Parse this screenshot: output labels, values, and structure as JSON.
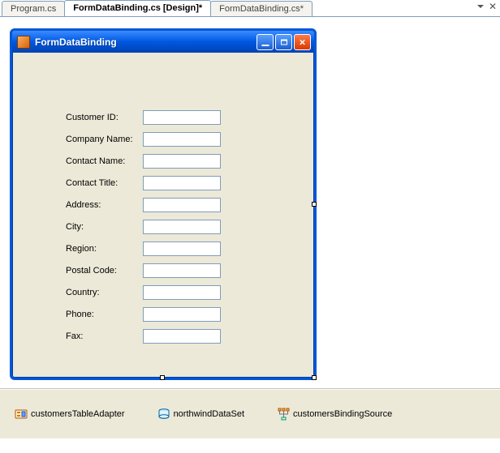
{
  "tabs": {
    "items": [
      {
        "label": "Program.cs"
      },
      {
        "label": "FormDataBinding.cs [Design]*"
      },
      {
        "label": "FormDataBinding.cs*"
      }
    ],
    "active_index": 1
  },
  "form": {
    "title": "FormDataBinding",
    "fields": [
      {
        "label": "Customer ID:"
      },
      {
        "label": "Company Name:"
      },
      {
        "label": "Contact Name:"
      },
      {
        "label": "Contact Title:"
      },
      {
        "label": "Address:"
      },
      {
        "label": "City:"
      },
      {
        "label": "Region:"
      },
      {
        "label": "Postal Code:"
      },
      {
        "label": "Country:"
      },
      {
        "label": "Phone:"
      },
      {
        "label": "Fax:"
      }
    ]
  },
  "tray": {
    "components": [
      {
        "name": "customersTableAdapter",
        "icon": "component-adapter-icon"
      },
      {
        "name": "northwindDataSet",
        "icon": "component-dataset-icon"
      },
      {
        "name": "customersBindingSource",
        "icon": "component-bindingsource-icon"
      }
    ]
  }
}
